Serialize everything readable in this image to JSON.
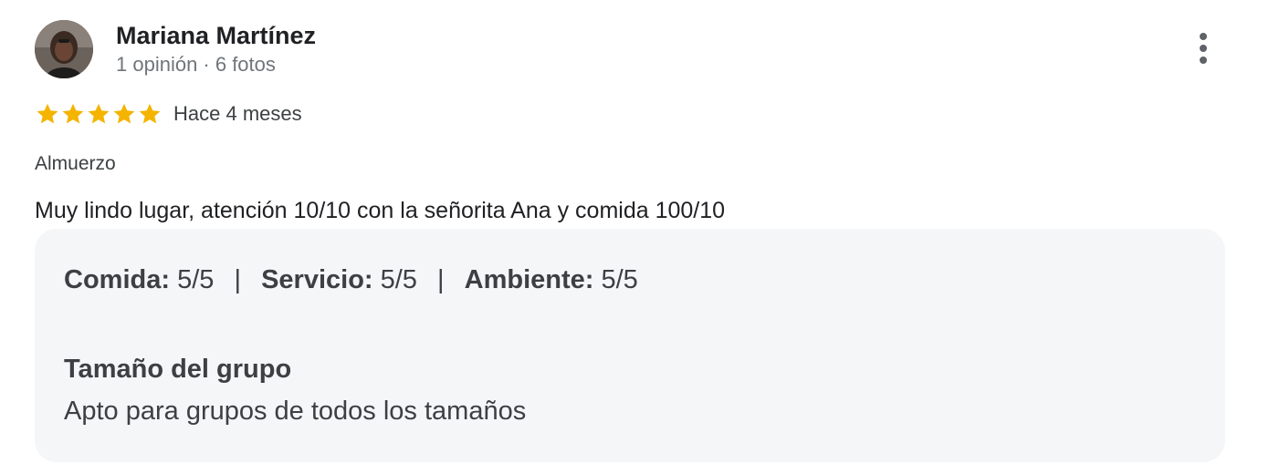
{
  "author": {
    "name": "Mariana Martínez",
    "meta": "1 opinión · 6 fotos"
  },
  "rating": {
    "stars": 5,
    "max_stars": 5,
    "star_color": "#f4b400",
    "time_ago": "Hace 4 meses"
  },
  "meal_type": "Almuerzo",
  "review_text": "Muy lindo lugar, atención 10/10 con la señorita Ana y comida 100/10",
  "details": {
    "ratings": [
      {
        "label": "Comida:",
        "value": "5/5"
      },
      {
        "label": "Servicio:",
        "value": "5/5"
      },
      {
        "label": "Ambiente:",
        "value": "5/5"
      }
    ],
    "separator": "|",
    "group_title": "Tamaño del grupo",
    "group_value": "Apto para grupos de todos los tamaños"
  },
  "icons": {
    "more": "more-vert-icon",
    "star": "star-icon"
  }
}
